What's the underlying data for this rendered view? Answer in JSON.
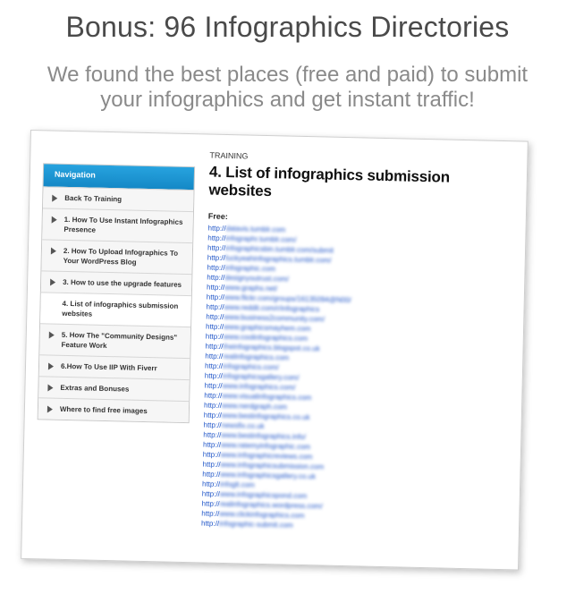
{
  "headline": "Bonus: 96 Infographics Directories",
  "subline_1": "We found the best places (free and paid)  to submit",
  "subline_2": "your infographics and get instant traffic!",
  "nav": {
    "header": "Navigation",
    "items": [
      "Back To Training",
      "1. How To Use Instant Infographics Presence",
      "2. How To Upload Infographics To Your WordPress Blog",
      "3. How to use the upgrade features",
      "4. List of infographics submission websites",
      "5. How The \"Community Designs\" Feature Work",
      "6.How To Use IIP With Fiverr",
      "Extras and Bonuses",
      "Where to find free images"
    ]
  },
  "content": {
    "breadcrumb": "TRAINING",
    "title": "4. List of infographics submission websites",
    "free_label": "Free:",
    "links": [
      "http://datavis.tumblr.com",
      "http://infographr.tumblr.com/",
      "http://infographicsbin.tumblr.com/submit",
      "http://fuckyeahinfographics.tumblr.com/",
      "http://infographic.com",
      "http://designyoutrust.com/",
      "http://www.graphs.net/",
      "http://www.flickr.com/groups/16135094@N00/",
      "http://www.reddit.com/r/infographics",
      "http://www.business2community.com/",
      "http://www.graphicsmayhem.com",
      "http://www.coolinfographics.com",
      "http://theinfographics.blogspot.co.uk",
      "http://realinfographics.com",
      "http://infographics.com/",
      "http://infographicsgallery.com/",
      "http://www.infographics.com/",
      "http://www.visualinfographics.com",
      "http://www.nerdgraph.com",
      "http://www.bestinfographics.co.uk",
      "http://newsfix.co.uk",
      "http://www.bestinfographics.info/",
      "http://www.ratemyinfographic.com",
      "http://www.infographicreviews.com",
      "http://www.infographicsubmission.com",
      "http://www.infographicsgallery.co.uk",
      "http://infoglt.com",
      "http://www.infographicspond.com",
      "http://realinfographics.wordpress.com/",
      "http://www.clickinfographics.com",
      "http://infographic-submit.com"
    ]
  }
}
